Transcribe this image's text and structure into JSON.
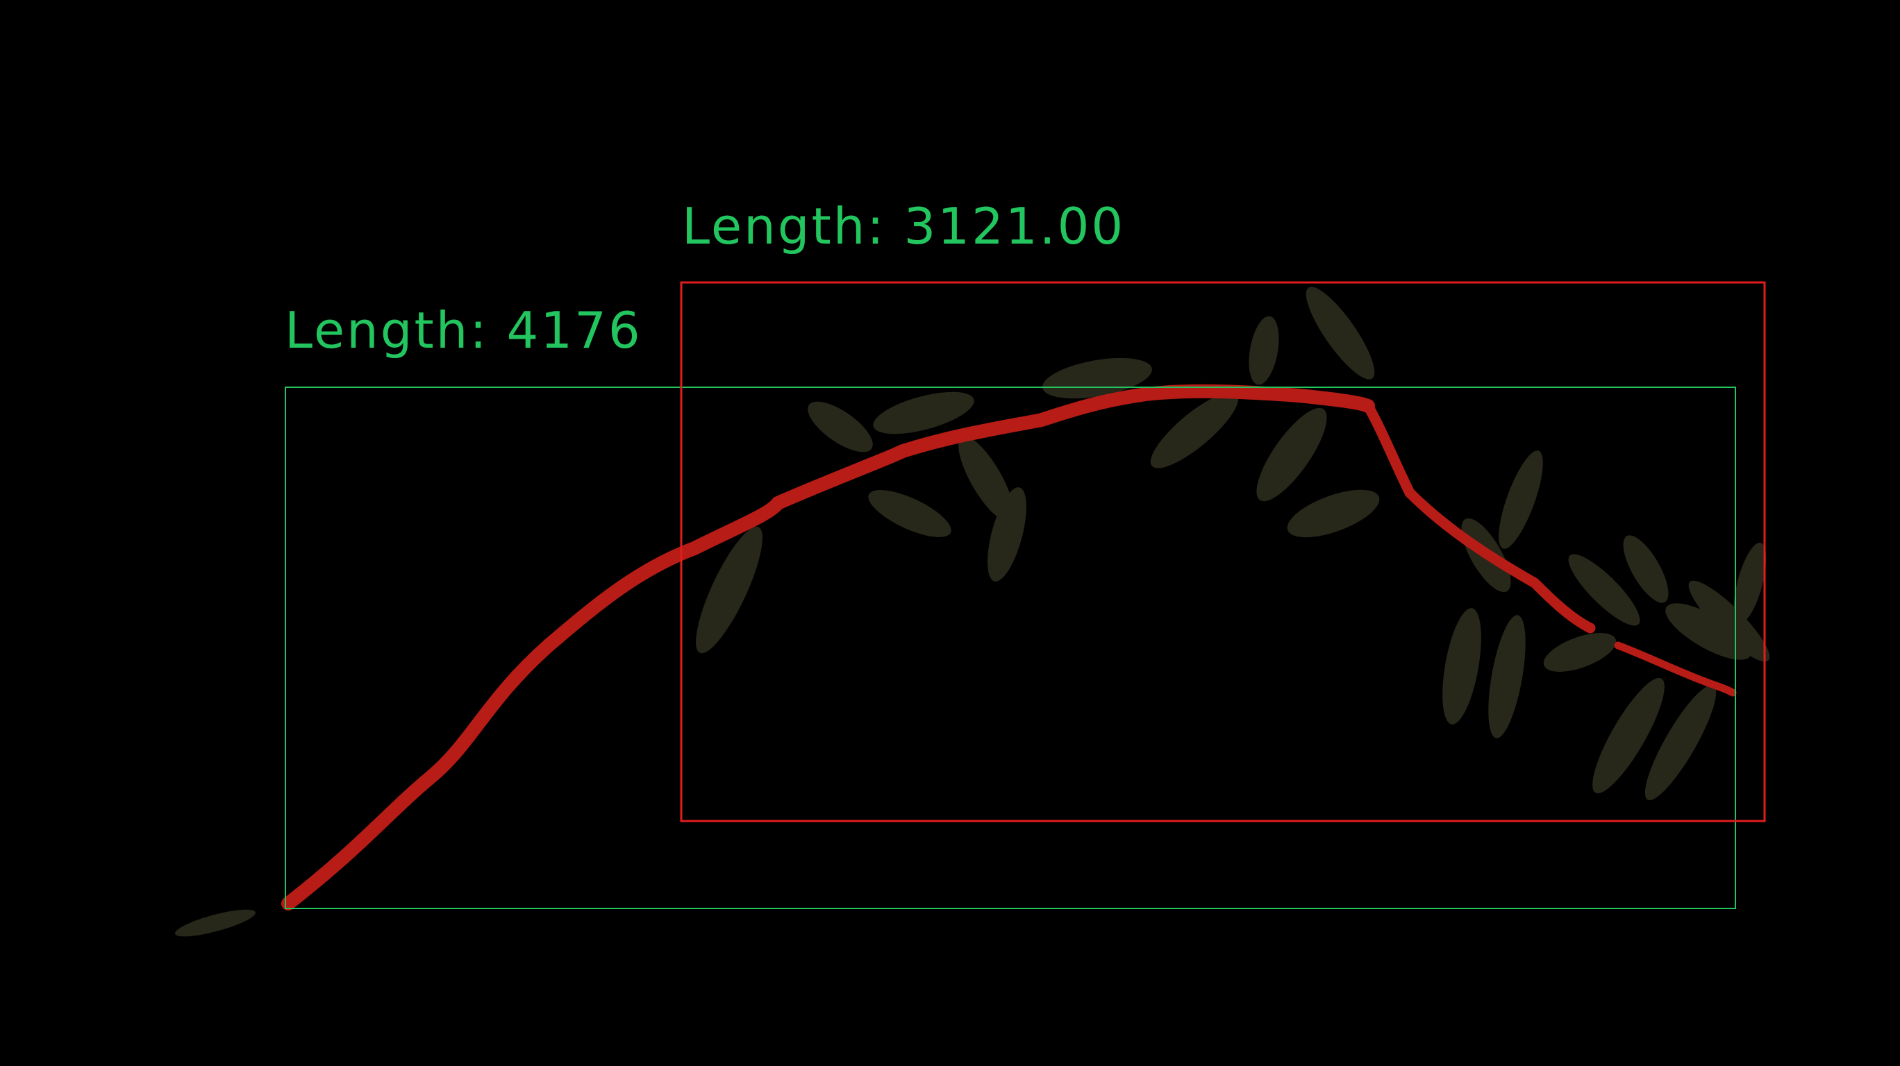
{
  "annotations": {
    "green_box": {
      "label": "Length: 4176",
      "color": "#22c55e"
    },
    "red_box": {
      "label": "Length: 3121.00",
      "color": "#e11d1d"
    }
  },
  "scene": {
    "background_color": "#000000",
    "stem_color": "#b81c16",
    "pod_color": "#2a2a1c"
  }
}
